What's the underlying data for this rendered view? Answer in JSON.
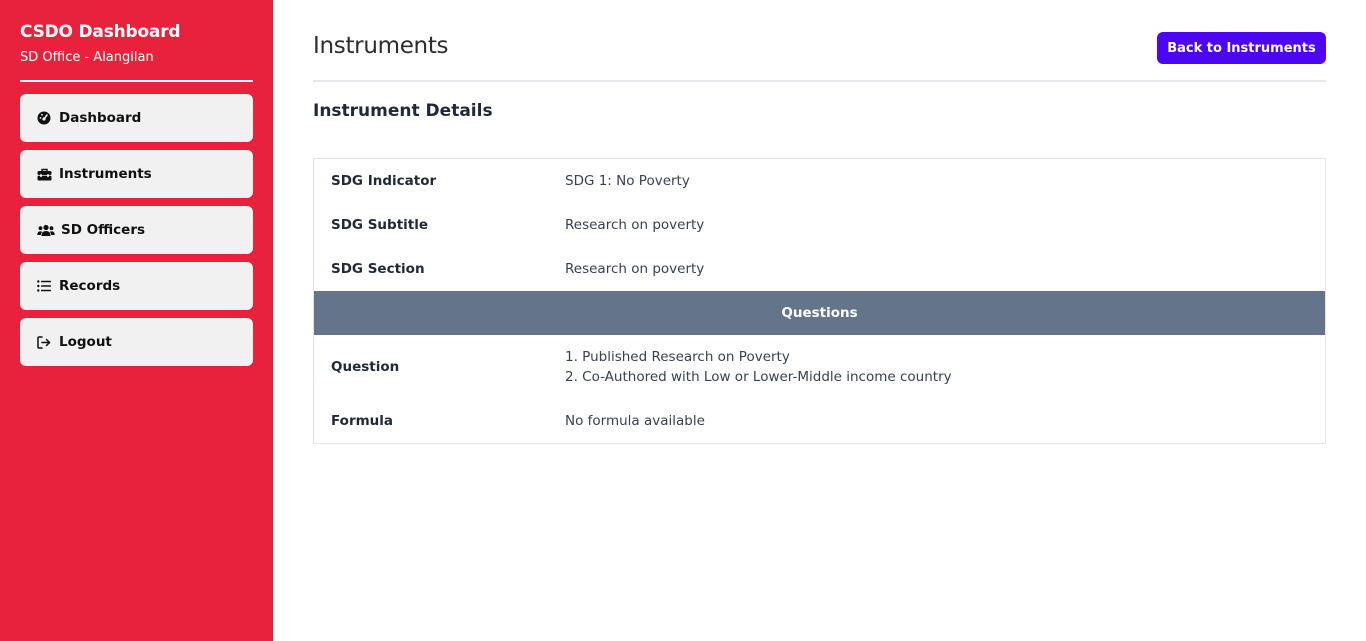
{
  "sidebar": {
    "brand_title": "CSDO Dashboard",
    "brand_subtitle": "SD Office - Alangilan",
    "items": [
      {
        "label": "Dashboard",
        "icon": "gauge-icon"
      },
      {
        "label": "Instruments",
        "icon": "toolbox-icon"
      },
      {
        "label": "SD Officers",
        "icon": "users-icon"
      },
      {
        "label": "Records",
        "icon": "list-icon"
      },
      {
        "label": "Logout",
        "icon": "logout-icon"
      }
    ]
  },
  "header": {
    "title": "Instruments",
    "back_button_label": "Back to Instruments"
  },
  "details": {
    "section_title": "Instrument Details",
    "rows": [
      {
        "label": "SDG Indicator",
        "value": "SDG 1: No Poverty"
      },
      {
        "label": "SDG Subtitle",
        "value": "Research on poverty"
      },
      {
        "label": "SDG Section",
        "value": "Research on poverty"
      }
    ],
    "questions_header": "Questions",
    "question": {
      "label": "Question",
      "items": [
        "1. Published Research on Poverty",
        "2. Co-Authored with Low or Lower-Middle income country"
      ]
    },
    "formula": {
      "label": "Formula",
      "value": "No formula available"
    }
  },
  "colors": {
    "sidebar_bg": "#e8223c",
    "accent_button": "#4c06f2",
    "questions_bar": "#64748b"
  }
}
